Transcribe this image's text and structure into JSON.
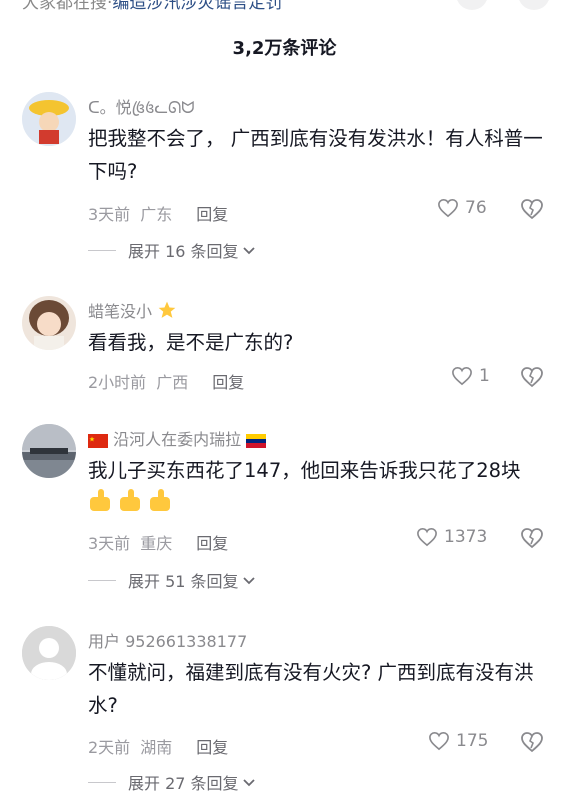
{
  "header": {
    "crumb_prefix": "大家都在搜·",
    "crumb_link": "编造涉汛涉灾谣言定罚",
    "close_icon": "close-icon",
    "dot_icon": "more-icon"
  },
  "comments_count": "3,2万条评论",
  "comments": [
    {
      "username": "ᑕ。悦꧔ꦿ꧔ᓚᘏᗢ",
      "text": "把我整不会了， 广西到底有没有发洪水！有人科普一下吗?",
      "time": "3天前",
      "location": "广东",
      "reply": "回复",
      "likes": "76",
      "expand": "展开 16 条回复"
    },
    {
      "username": "蜡笔没小",
      "text": "看看我，是不是广东的?",
      "time": "2小时前",
      "location": "广西",
      "reply": "回复",
      "likes": "1"
    },
    {
      "username": "沿河人在委内瑞拉",
      "text": "我儿子买东西花了147，他回来告诉我只花了28块",
      "time": "3天前",
      "location": "重庆",
      "reply": "回复",
      "likes": "1373",
      "expand": "展开 51 条回复"
    },
    {
      "username": "用户 952661338177",
      "text": "不懂就问，福建到底有没有火灾? 广西到底有没有洪水?",
      "time": "2天前",
      "location": "湖南",
      "reply": "回复",
      "likes": "175",
      "expand": "展开 27 条回复"
    }
  ],
  "colors": {
    "text": "#161823",
    "meta": "#9a9aa0",
    "link": "#2d4f86"
  }
}
